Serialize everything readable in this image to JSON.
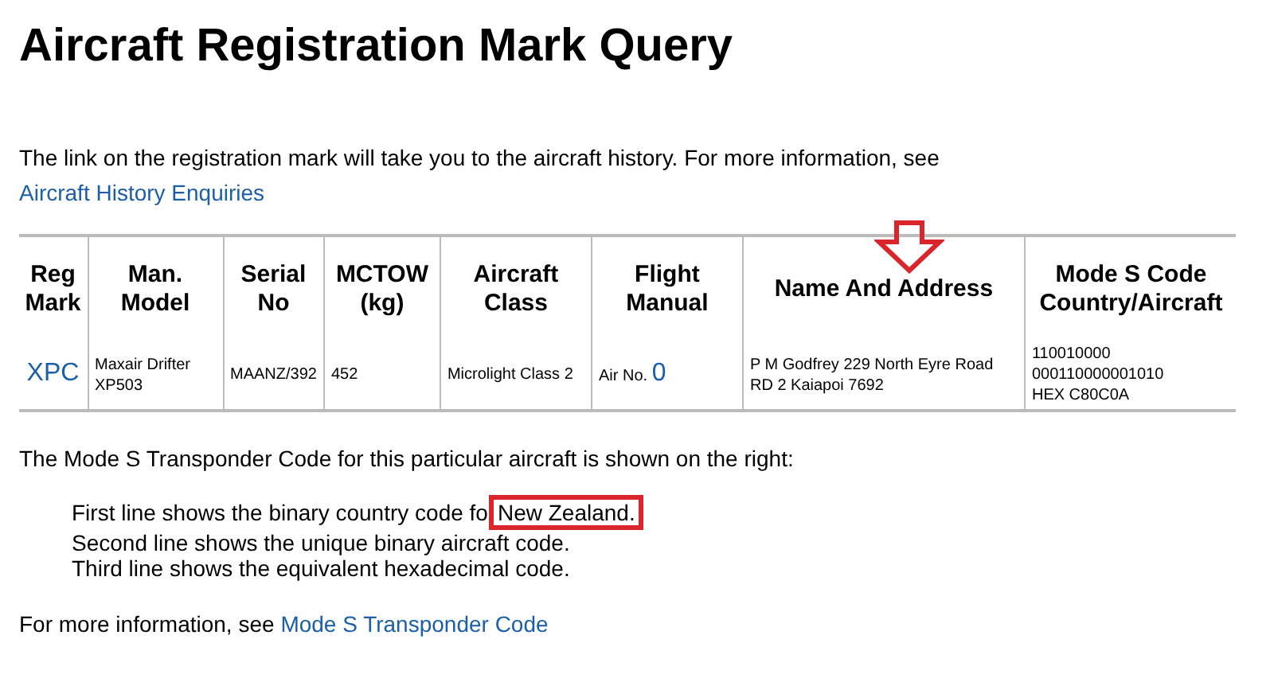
{
  "title": "Aircraft Registration Mark Query",
  "intro": {
    "text": "The link on the registration mark will take you to the aircraft history. For more information, see",
    "link": "Aircraft History Enquiries"
  },
  "table": {
    "columns": [
      "Reg Mark",
      "Man. Model",
      "Serial No",
      "MCTOW (kg)",
      "Aircraft Class",
      "Flight Manual",
      "Name And Address",
      "Mode S Code Country/Aircraft"
    ],
    "rows": [
      {
        "reg_mark": "XPC",
        "man_model": "Maxair Drifter XP503",
        "serial_no": "MAANZ/392",
        "mctow": "452",
        "aircraft_class": "Microlight Class 2",
        "flight_manual": {
          "label": "Air No.",
          "link": "0"
        },
        "name_address": "P M Godfrey 229 North Eyre Road RD 2 Kaiapoi 7692",
        "mode_s": [
          "110010000",
          "000110000001010",
          "HEX C80C0A"
        ]
      }
    ]
  },
  "note": "The Mode S Transponder Code for this particular aircraft is shown on the right:",
  "explanation": {
    "first_line": "First line shows the binary country code fo",
    "highlight": "New Zealand.",
    "other_lines": [
      "Second line shows the unique binary aircraft code.",
      "Third line shows the equivalent hexadecimal code."
    ]
  },
  "footer": {
    "text": "For more information, see",
    "link": "Mode S Transponder Code"
  }
}
